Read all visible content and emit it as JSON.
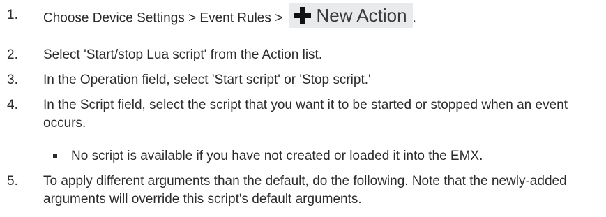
{
  "steps": [
    {
      "num": "1.",
      "text": "Choose Device Settings > Event Rules > ",
      "button_label": "New Action",
      "trail": "."
    },
    {
      "num": "2.",
      "text": "Select 'Start/stop Lua script' from the Action list."
    },
    {
      "num": "3.",
      "text": "In the Operation field, select 'Start script' or 'Stop script.'"
    },
    {
      "num": "4.",
      "text": "In the Script field, select the script that you want it to be started or stopped when an event occurs."
    },
    {
      "num": "5.",
      "text": "To apply different arguments than the default, do the following. Note that the newly-added arguments will override this script's default arguments."
    }
  ],
  "sub_bullet": "No script is available if you have not created or loaded it into the EMX.",
  "icons": {
    "new_action": "plus-icon"
  },
  "colors": {
    "text": "#2b2b2b",
    "button_bg": "#e9eaeb",
    "plus": "#111111"
  }
}
